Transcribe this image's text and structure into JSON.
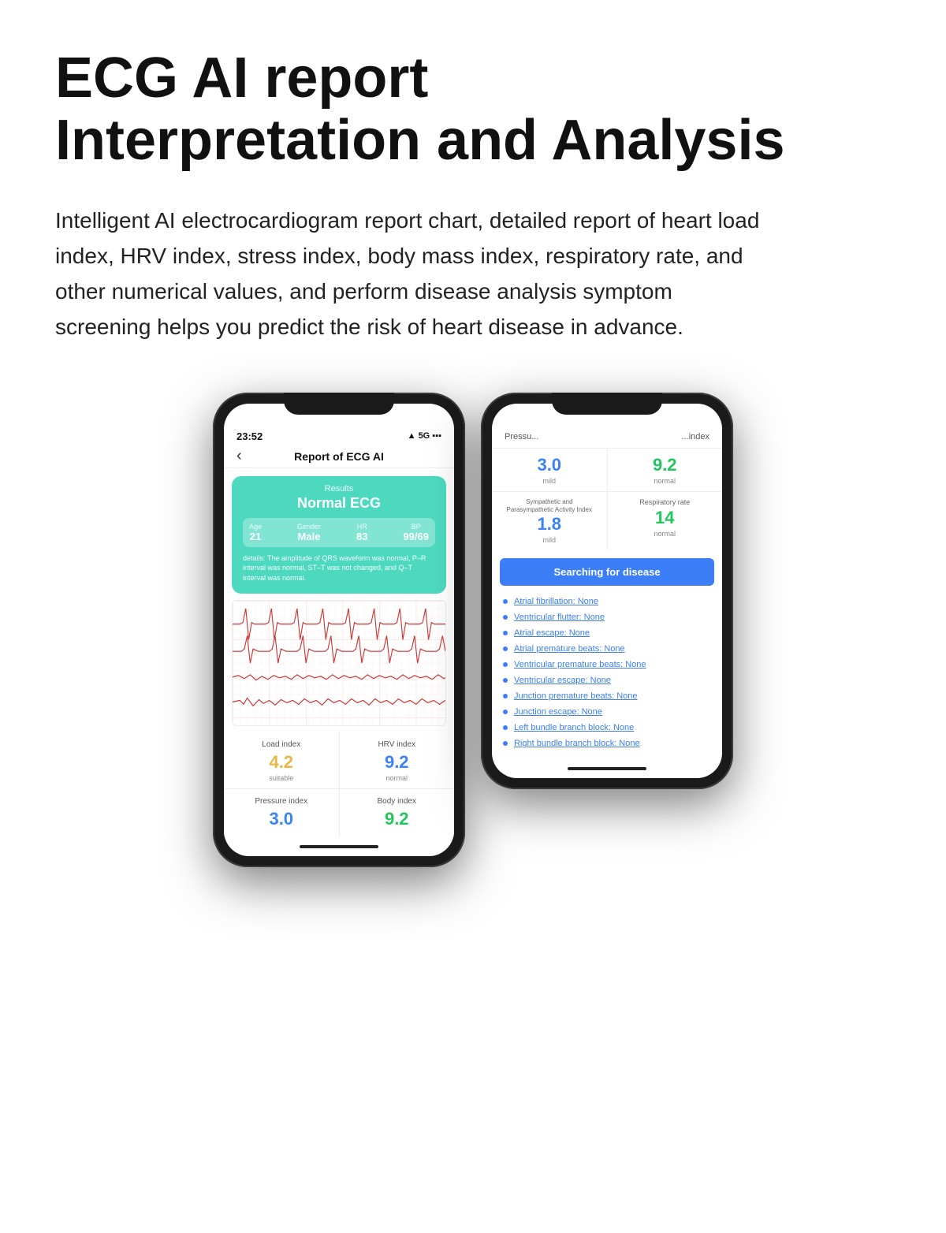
{
  "header": {
    "title_line1": "ECG AI report",
    "title_line2": "Interpretation and Analysis",
    "description": "Intelligent AI electrocardiogram report chart, detailed report of heart load index, HRV index, stress index, body mass index, respiratory rate, and other numerical values, and perform disease analysis symptom screening helps you predict the risk of heart disease in advance."
  },
  "phone1": {
    "status": {
      "time": "23:52",
      "signal": "▲",
      "network": "5G",
      "battery": "■"
    },
    "nav": {
      "back": "‹",
      "title": "Report of ECG AI"
    },
    "results": {
      "label": "Results",
      "value": "Normal ECG",
      "stats": [
        {
          "label": "Age",
          "value": "21"
        },
        {
          "label": "Gender",
          "value": "Male"
        },
        {
          "label": "HR",
          "value": "83"
        },
        {
          "label": "BP",
          "value": "99/69"
        }
      ],
      "details": "details: The amplitude of QRS waveform was normal, P–R interval was normal, ST–T was not changed, and Q–T interval was normal."
    },
    "metrics": [
      {
        "label": "Load index",
        "value": "4.2",
        "sub": "suitable",
        "color": "yellow"
      },
      {
        "label": "HRV index",
        "value": "9.2",
        "sub": "normal",
        "color": "blue"
      },
      {
        "label": "Pressure index",
        "value": "3.0",
        "sub": "",
        "color": "blue"
      },
      {
        "label": "Body index",
        "value": "9.2",
        "sub": "",
        "color": "green"
      }
    ]
  },
  "phone2": {
    "header_left": "Pressu...",
    "header_right": "...index",
    "top_metrics": [
      {
        "value": "3.0",
        "sub": "mild",
        "color": "blue"
      },
      {
        "value": "9.2",
        "sub": "normal",
        "color": "green"
      }
    ],
    "bottom_metrics": [
      {
        "label": "Sympathetic and\nParasympathetic Activity Index",
        "value": "1.8",
        "sub": "mild",
        "color": "blue"
      },
      {
        "label": "Respiratory rate",
        "value": "14",
        "sub": "normal",
        "color": "green"
      }
    ],
    "search_btn": "Searching for disease",
    "diseases": [
      {
        "text": "Atrial fibrillation: None"
      },
      {
        "text": "Ventricular flutter: None"
      },
      {
        "text": "Atrial escape: None"
      },
      {
        "text": "Atrial premature beats: None"
      },
      {
        "text": "Ventricular premature beats: None"
      },
      {
        "text": "Ventricular escape: None"
      },
      {
        "text": "Junction premature beats: None"
      },
      {
        "text": "Junction escape: None"
      },
      {
        "text": "Left bundle branch block: None"
      },
      {
        "text": "Right bundle branch block: None"
      }
    ]
  }
}
